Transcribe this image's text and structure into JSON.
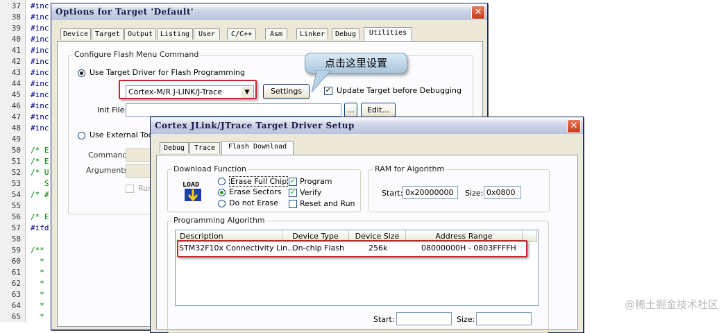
{
  "editor": {
    "lines": [
      {
        "n": "37",
        "t": "#inc"
      },
      {
        "n": "38",
        "t": "#inc"
      },
      {
        "n": "39",
        "t": "#inc"
      },
      {
        "n": "40",
        "t": "#inc"
      },
      {
        "n": "41",
        "t": "#inc"
      },
      {
        "n": "42",
        "t": "#inc"
      },
      {
        "n": "43",
        "t": "#inc"
      },
      {
        "n": "44",
        "t": "#inc"
      },
      {
        "n": "45",
        "t": "#inc"
      },
      {
        "n": "46",
        "t": "#inc"
      },
      {
        "n": "47",
        "t": "#inc"
      },
      {
        "n": "48",
        "t": "#inc"
      },
      {
        "n": "49",
        "t": ""
      },
      {
        "n": "50",
        "t": "/* E"
      },
      {
        "n": "51",
        "t": "/* E"
      },
      {
        "n": "52",
        "t": "/* U"
      },
      {
        "n": "53",
        "t": "   S"
      },
      {
        "n": "54",
        "t": "/* #"
      },
      {
        "n": "55",
        "t": ""
      },
      {
        "n": "56",
        "t": "/* E"
      },
      {
        "n": "57",
        "t": "#ifd"
      },
      {
        "n": "58",
        "t": ""
      },
      {
        "n": "59",
        "t": "/**"
      },
      {
        "n": "60",
        "t": "  *"
      },
      {
        "n": "61",
        "t": "  *"
      },
      {
        "n": "62",
        "t": "  *"
      },
      {
        "n": "63",
        "t": "  *"
      },
      {
        "n": "64",
        "t": "  *"
      },
      {
        "n": "65",
        "t": "  *"
      }
    ]
  },
  "watermark": "@稀土掘金技术社区",
  "options_dialog": {
    "title": "Options for Target 'Default'",
    "close": "✕",
    "tabs": [
      "Device",
      "Target",
      "Output",
      "Listing",
      "User",
      "C/C++",
      "Asm",
      "Linker",
      "Debug",
      "Utilities"
    ],
    "active_tab": "Utilities",
    "group_label": "Configure Flash Menu Command",
    "use_target_driver": "Use Target Driver for Flash Programming",
    "driver_selected": "Cortex-M/R J-LINK/J-Trace",
    "settings_btn": "Settings",
    "update_target": "Update Target before Debugging",
    "init_file_label": "Init File:",
    "browse_btn": "...",
    "edit_btn": "Edit...",
    "use_external_tool": "Use External Tool for Flash Programming",
    "command_label": "Command:",
    "arguments_label": "Arguments:",
    "run_independent": "Run Independent"
  },
  "callout": {
    "text": "点击这里设置"
  },
  "jlink_dialog": {
    "title": "Cortex JLink/JTrace Target Driver Setup",
    "close": "✕",
    "tabs": [
      "Debug",
      "Trace",
      "Flash Download"
    ],
    "active_tab": "Flash Download",
    "download_function": {
      "label": "Download Function",
      "load_icon_text": "LOAD",
      "erase_full_chip": "Erase Full Chip",
      "erase_sectors": "Erase Sectors",
      "do_not_erase": "Do not Erase",
      "program": "Program",
      "verify": "Verify",
      "reset_and_run": "Reset and Run"
    },
    "ram_for_algorithm": {
      "label": "RAM for Algorithm",
      "start_label": "Start:",
      "start_value": "0x20000000",
      "size_label": "Size:",
      "size_value": "0x0800"
    },
    "programming_algorithm": {
      "label": "Programming Algorithm",
      "columns": [
        "Description",
        "Device Type",
        "Device Size",
        "Address Range"
      ],
      "rows": [
        {
          "description": "STM32F10x Connectivity Lin...",
          "device_type": "On-chip Flash",
          "device_size": "256k",
          "address_range": "08000000H - 0803FFFFH"
        }
      ],
      "start_label": "Start:",
      "size_label": "Size:"
    }
  }
}
